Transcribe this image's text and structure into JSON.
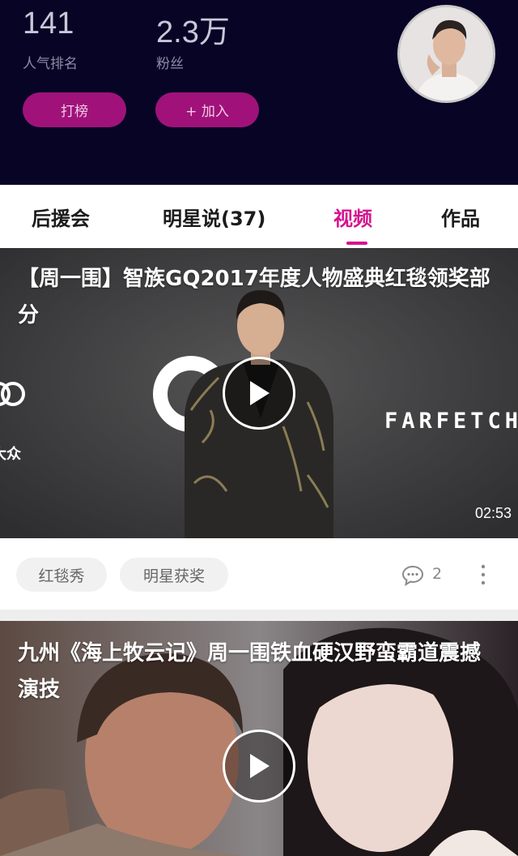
{
  "profile": {
    "popularity_rank": "141",
    "popularity_label": "人气排名",
    "fans_count": "2.3万",
    "fans_label": "粉丝",
    "vote_button": "打榜",
    "join_button": "+ 加入"
  },
  "tabs": [
    {
      "label": "后援会"
    },
    {
      "label": "明星说(37)"
    },
    {
      "label": "视频"
    },
    {
      "label": "作品"
    }
  ],
  "active_tab": "视频",
  "videos": [
    {
      "title": "【周一围】智族GQ2017年度人物盛典红毯领奖部分",
      "duration": "02:53",
      "backdrop_text": "FARFETCH",
      "backdrop_side_text": "大众",
      "tags": [
        "红毯秀",
        "明星获奖"
      ],
      "comments": "2"
    },
    {
      "title": "九州《海上牧云记》周一围铁血硬汉野蛮霸道震撼演技"
    }
  ],
  "colors": {
    "header_bg": "#070426",
    "accent": "#d5148d",
    "pill_bg": "#a0127a"
  }
}
